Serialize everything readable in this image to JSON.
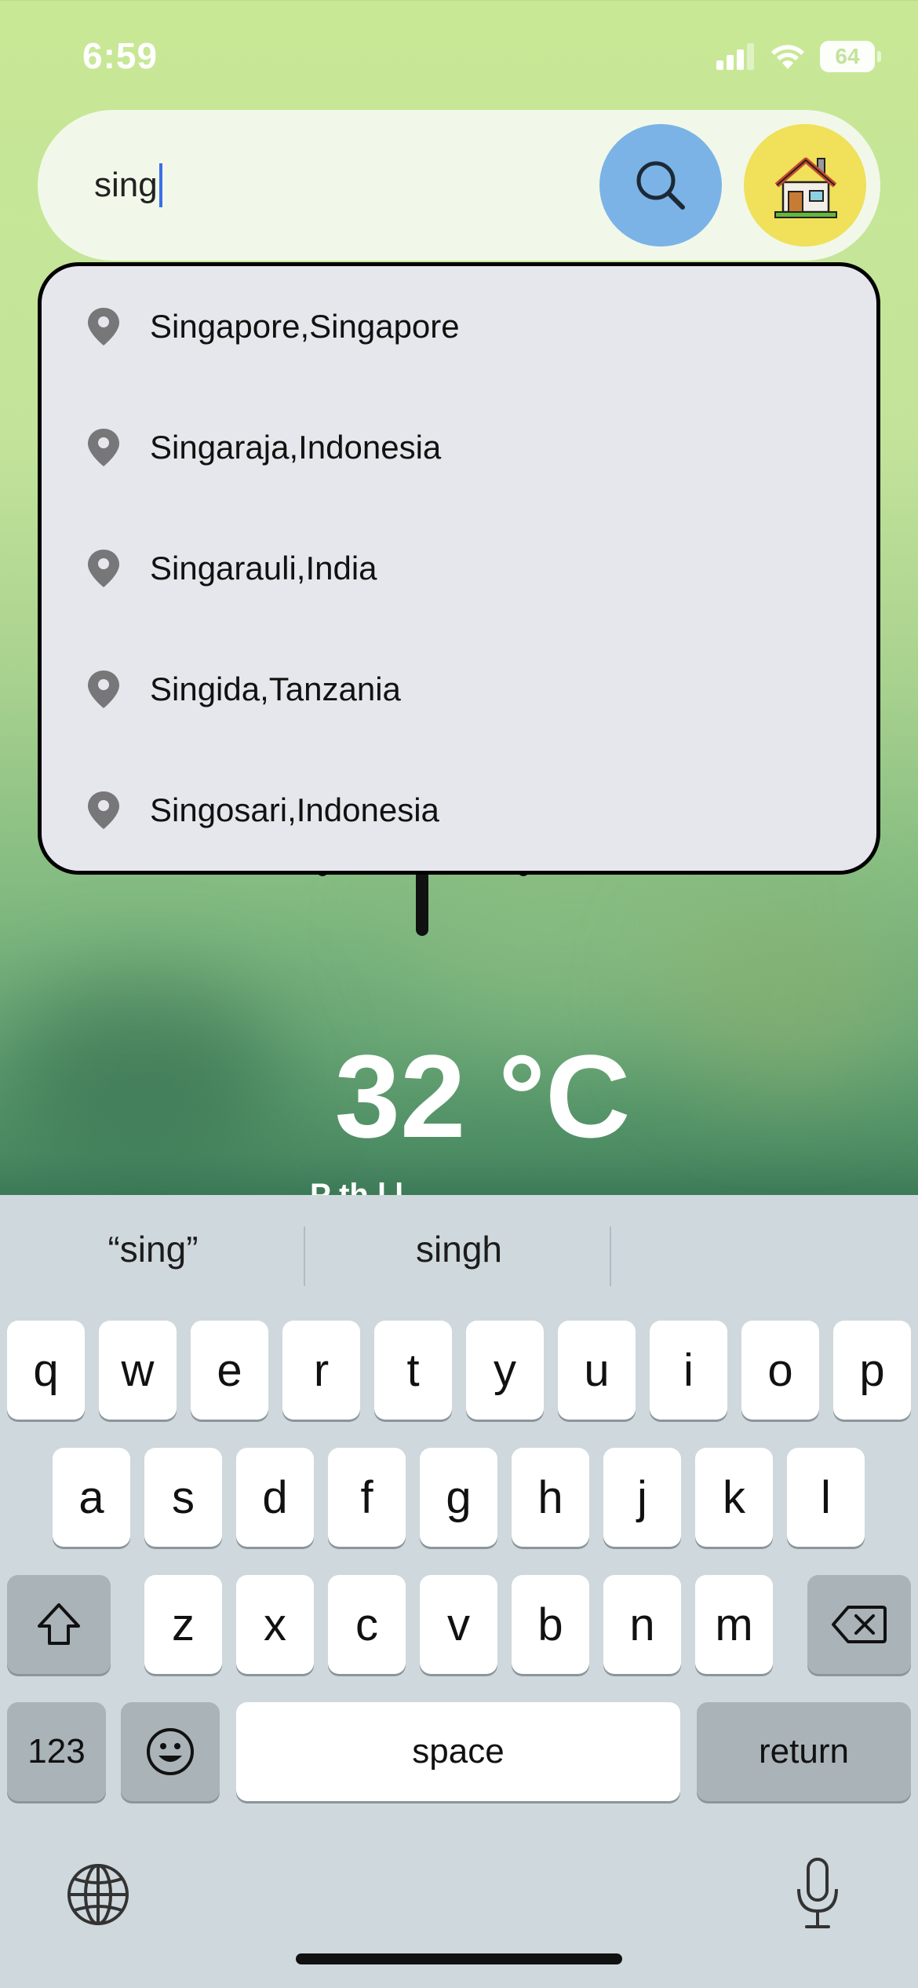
{
  "status_bar": {
    "time": "6:59",
    "battery": "64"
  },
  "search": {
    "value": "sing"
  },
  "suggestions": [
    {
      "label": "Singapore,Singapore"
    },
    {
      "label": "Singaraja,Indonesia"
    },
    {
      "label": "Singarauli,India"
    },
    {
      "label": "Singida,Tanzania"
    },
    {
      "label": "Singosari,Indonesia"
    }
  ],
  "weather": {
    "temperature": "32 °C",
    "condition_partial": "P  th  l  l"
  },
  "keyboard": {
    "predictions": [
      "“sing”",
      "singh"
    ],
    "row1": [
      "q",
      "w",
      "e",
      "r",
      "t",
      "y",
      "u",
      "i",
      "o",
      "p"
    ],
    "row2": [
      "a",
      "s",
      "d",
      "f",
      "g",
      "h",
      "j",
      "k",
      "l"
    ],
    "row3": [
      "z",
      "x",
      "c",
      "v",
      "b",
      "n",
      "m"
    ],
    "numbers_label": "123",
    "space_label": "space",
    "return_label": "return"
  },
  "colors": {
    "search_button": "#7bb3e6",
    "home_button": "#f0e05a",
    "caret": "#3a6fe6"
  }
}
